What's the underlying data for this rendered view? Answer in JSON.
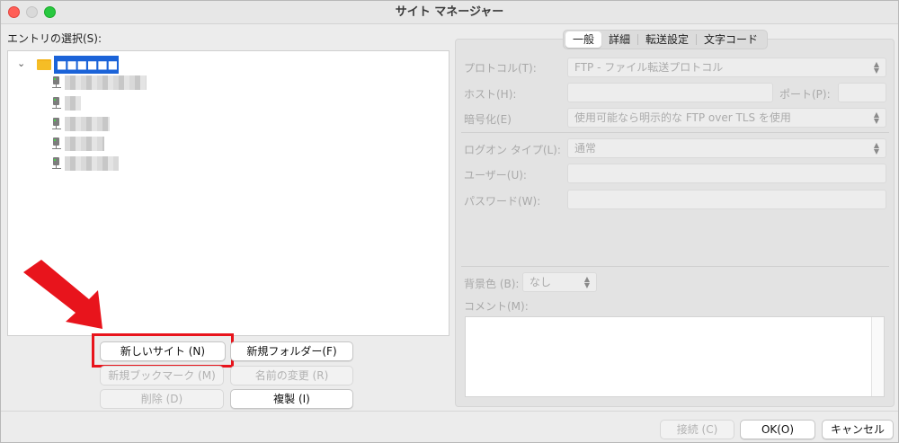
{
  "window": {
    "title": "サイト マネージャー"
  },
  "entry_select_label": "エントリの選択(S):",
  "tree": {
    "folder_label": "■■■■■■",
    "sites": [
      {
        "label": "■■■■■■■■■■"
      },
      {
        "label": "■■"
      },
      {
        "label": "■■■■■"
      },
      {
        "label": "■■■■"
      },
      {
        "label": "■■■■■■"
      }
    ]
  },
  "buttons": {
    "new_site": "新しいサイト (N)",
    "new_folder": "新規フォルダー(F)",
    "new_bookmark": "新規ブックマーク (M)",
    "rename": "名前の変更 (R)",
    "delete": "削除 (D)",
    "duplicate": "複製 (I)",
    "connect": "接続 (C)",
    "ok": "OK(O)",
    "cancel": "キャンセル"
  },
  "tabs": [
    {
      "label": "一般",
      "active": true
    },
    {
      "label": "詳細",
      "active": false
    },
    {
      "label": "転送設定",
      "active": false
    },
    {
      "label": "文字コード",
      "active": false
    }
  ],
  "form": {
    "protocol_label": "プロトコル(T):",
    "protocol_value": "FTP - ファイル転送プロトコル",
    "host_label": "ホスト(H):",
    "host_value": "",
    "port_label": "ポート(P):",
    "port_value": "",
    "encryption_label": "暗号化(E)",
    "encryption_value": "使用可能なら明示的な FTP over TLS を使用",
    "logon_type_label": "ログオン タイプ(L):",
    "logon_type_value": "通常",
    "user_label": "ユーザー(U):",
    "user_value": "",
    "password_label": "パスワード(W):",
    "password_value": "",
    "background_label": "背景色 (B):",
    "background_value": "なし",
    "comment_label": "コメント(M):",
    "comment_value": ""
  },
  "colors": {
    "accent_selection": "#1b63d8",
    "annotation_red": "#e8141c",
    "folder_yellow": "#f5bd26"
  },
  "icons": {
    "folder": "folder-icon",
    "server": "server-icon",
    "chevron": "chevron-down-icon",
    "annotation": "red-arrow-annotation"
  }
}
